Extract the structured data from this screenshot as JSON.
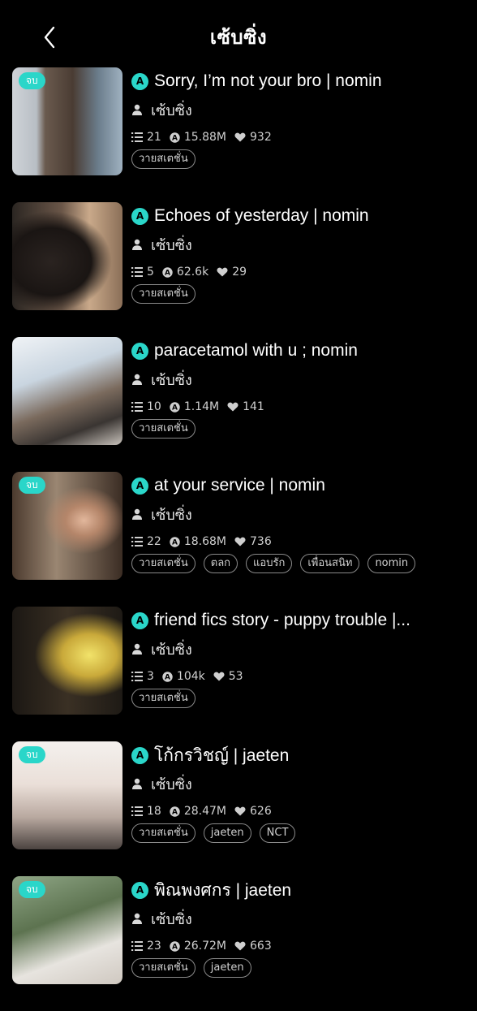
{
  "header": {
    "title": "เซ้บซิ่ง"
  },
  "stories": [
    {
      "badge": "จบ",
      "title": "Sorry, I’m not your bro | nomin",
      "author": "เซ้บซิ่ง",
      "chapters": "21",
      "views": "15.88M",
      "likes": "932",
      "tags": [
        "วายสเตชั่น"
      ]
    },
    {
      "badge": "",
      "title": "Echoes of yesterday | nomin",
      "author": "เซ้บซิ่ง",
      "chapters": "5",
      "views": "62.6k",
      "likes": "29",
      "tags": [
        "วายสเตชั่น"
      ]
    },
    {
      "badge": "",
      "title": "paracetamol with u ; nomin",
      "author": "เซ้บซิ่ง",
      "chapters": "10",
      "views": "1.14M",
      "likes": "141",
      "tags": [
        "วายสเตชั่น"
      ]
    },
    {
      "badge": "จบ",
      "title": "at your service | nomin",
      "author": "เซ้บซิ่ง",
      "chapters": "22",
      "views": "18.68M",
      "likes": "736",
      "tags": [
        "วายสเตชั่น",
        "ตลก",
        "แอบรัก",
        "เพื่อนสนิท",
        "nomin"
      ]
    },
    {
      "badge": "",
      "title": "friend fics story - puppy trouble |...",
      "author": "เซ้บซิ่ง",
      "chapters": "3",
      "views": "104k",
      "likes": "53",
      "tags": [
        "วายสเตชั่น"
      ]
    },
    {
      "badge": "จบ",
      "title": "โก้กรวิชญ์ | jaeten",
      "author": "เซ้บซิ่ง",
      "chapters": "18",
      "views": "28.47M",
      "likes": "626",
      "tags": [
        "วายสเตชั่น",
        "jaeten",
        "NCT"
      ]
    },
    {
      "badge": "จบ",
      "title": "พิณพงศกร | jaeten",
      "author": "เซ้บซิ่ง",
      "chapters": "23",
      "views": "26.72M",
      "likes": "663",
      "tags": [
        "วายสเตชั่น",
        "jaeten"
      ]
    }
  ],
  "colors": {
    "accent": "#2ad6c9",
    "background": "#000000"
  },
  "icons": {
    "back": "chevron-left-icon",
    "author": "person-icon",
    "chapters": "list-icon",
    "views": "reads-icon",
    "likes": "heart-icon"
  }
}
